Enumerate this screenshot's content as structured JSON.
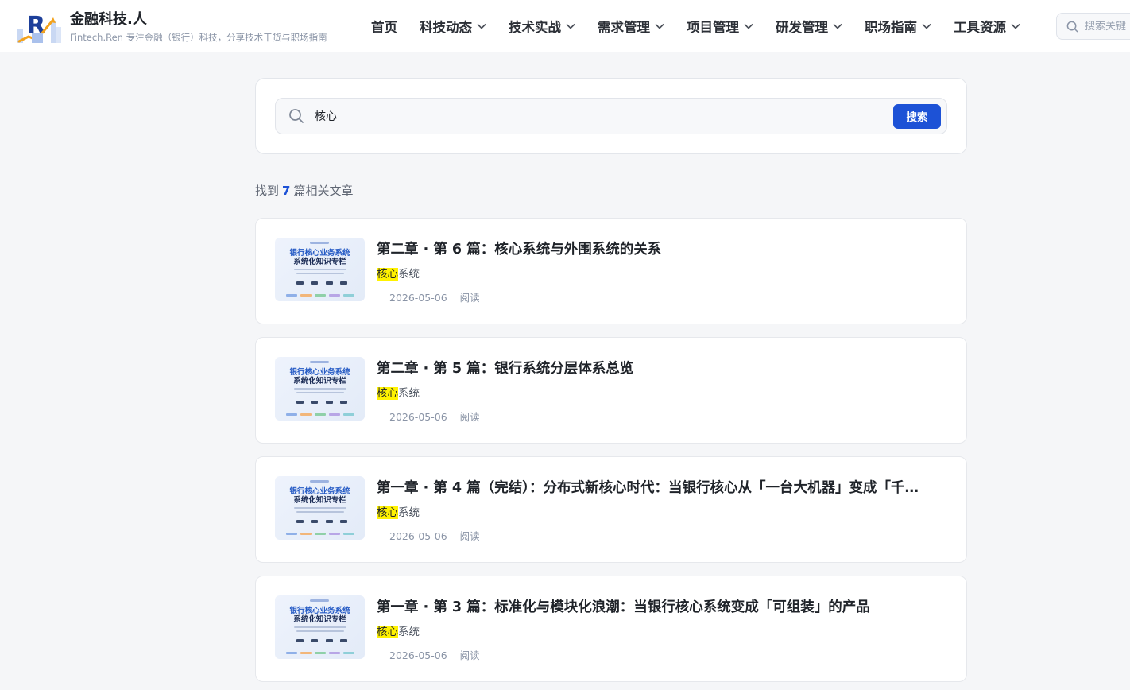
{
  "header": {
    "brand_title": "金融科技.人",
    "brand_subtitle": "Fintech.Ren 专注金融（银行）科技，分享技术干货与职场指南",
    "logo_icon": "fintech-ren-logo",
    "nav": [
      {
        "label": "首页",
        "has_dropdown": false
      },
      {
        "label": "科技动态",
        "has_dropdown": true
      },
      {
        "label": "技术实战",
        "has_dropdown": true
      },
      {
        "label": "需求管理",
        "has_dropdown": true
      },
      {
        "label": "项目管理",
        "has_dropdown": true
      },
      {
        "label": "研发管理",
        "has_dropdown": true
      },
      {
        "label": "职场指南",
        "has_dropdown": true
      },
      {
        "label": "工具资源",
        "has_dropdown": true
      }
    ],
    "search_placeholder": "搜索关键"
  },
  "search": {
    "query": "核心",
    "button_label": "搜索"
  },
  "results": {
    "prefix": "找到",
    "count": "7",
    "suffix": "篇相关文章"
  },
  "articles": [
    {
      "title": "第二章 · 第 6 篇：核心系统与外围系统的关系",
      "tag_highlight": "核心",
      "tag_rest": "系统",
      "date": "2026-05-06",
      "read_label": "阅读",
      "thumb_line1": "银行核心业务系统",
      "thumb_line2": "系统化知识专栏"
    },
    {
      "title": "第二章 · 第 5 篇：银行系统分层体系总览",
      "tag_highlight": "核心",
      "tag_rest": "系统",
      "date": "2026-05-06",
      "read_label": "阅读",
      "thumb_line1": "银行核心业务系统",
      "thumb_line2": "系统化知识专栏"
    },
    {
      "title": "第一章 · 第 4 篇（完结）：分布式新核心时代：当银行核心从「一台大机器」变成「千…",
      "tag_highlight": "核心",
      "tag_rest": "系统",
      "date": "2026-05-06",
      "read_label": "阅读",
      "thumb_line1": "银行核心业务系统",
      "thumb_line2": "系统化知识专栏"
    },
    {
      "title": "第一章 · 第 3 篇：标准化与模块化浪潮：当银行核心系统变成「可组装」的产品",
      "tag_highlight": "核心",
      "tag_rest": "系统",
      "date": "2026-05-06",
      "read_label": "阅读",
      "thumb_line1": "银行核心业务系统",
      "thumb_line2": "系统化知识专栏"
    }
  ],
  "colors": {
    "accent": "#1d52d6",
    "highlight": "#fff200",
    "page_bg": "#f5f6f8"
  }
}
